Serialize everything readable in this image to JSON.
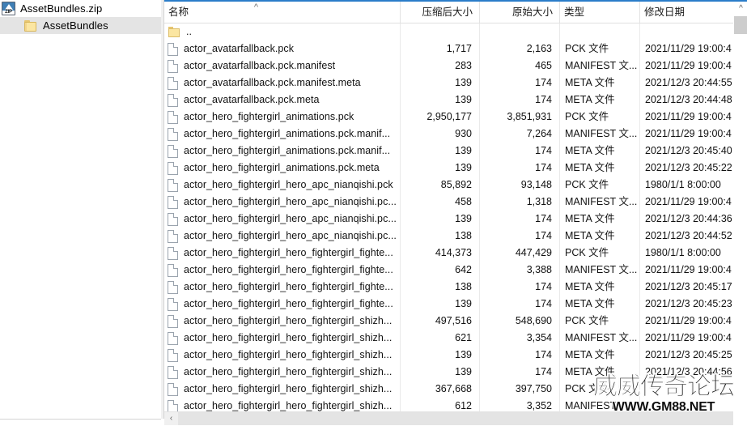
{
  "window": {
    "accent_color": "#2a7dc9"
  },
  "tree": {
    "root": {
      "label": "AssetBundles.zip",
      "icon": "zip-archive-icon"
    },
    "child": {
      "label": "AssetBundles",
      "icon": "folder-icon",
      "selected": true
    }
  },
  "list": {
    "columns": [
      {
        "key": "name",
        "label": "名称",
        "align": "left"
      },
      {
        "key": "csize",
        "label": "压缩后大小",
        "align": "right"
      },
      {
        "key": "osize",
        "label": "原始大小",
        "align": "right"
      },
      {
        "key": "type",
        "label": "类型",
        "align": "left"
      },
      {
        "key": "date",
        "label": "修改日期",
        "align": "left"
      }
    ],
    "sort": {
      "column": "名称",
      "direction": "ascending",
      "glyph": "^"
    },
    "rows": [
      {
        "icon": "folder-icon",
        "name": "..",
        "csize": "",
        "osize": "",
        "type": "",
        "date": ""
      },
      {
        "icon": "file-icon",
        "name": "actor_avatarfallback.pck",
        "csize": "1,717",
        "osize": "2,163",
        "type": "PCK 文件",
        "date": "2021/11/29 19:00:4"
      },
      {
        "icon": "file-icon",
        "name": "actor_avatarfallback.pck.manifest",
        "csize": "283",
        "osize": "465",
        "type": "MANIFEST 文...",
        "date": "2021/11/29 19:00:4"
      },
      {
        "icon": "file-icon",
        "name": "actor_avatarfallback.pck.manifest.meta",
        "csize": "139",
        "osize": "174",
        "type": "META 文件",
        "date": "2021/12/3 20:44:55"
      },
      {
        "icon": "file-icon",
        "name": "actor_avatarfallback.pck.meta",
        "csize": "139",
        "osize": "174",
        "type": "META 文件",
        "date": "2021/12/3 20:44:48"
      },
      {
        "icon": "file-icon",
        "name": "actor_hero_fightergirl_animations.pck",
        "csize": "2,950,177",
        "osize": "3,851,931",
        "type": "PCK 文件",
        "date": "2021/11/29 19:00:4"
      },
      {
        "icon": "file-icon",
        "name": "actor_hero_fightergirl_animations.pck.manif...",
        "csize": "930",
        "osize": "7,264",
        "type": "MANIFEST 文...",
        "date": "2021/11/29 19:00:4"
      },
      {
        "icon": "file-icon",
        "name": "actor_hero_fightergirl_animations.pck.manif...",
        "csize": "139",
        "osize": "174",
        "type": "META 文件",
        "date": "2021/12/3 20:45:40"
      },
      {
        "icon": "file-icon",
        "name": "actor_hero_fightergirl_animations.pck.meta",
        "csize": "139",
        "osize": "174",
        "type": "META 文件",
        "date": "2021/12/3 20:45:22"
      },
      {
        "icon": "file-icon",
        "name": "actor_hero_fightergirl_hero_apc_nianqishi.pck",
        "csize": "85,892",
        "osize": "93,148",
        "type": "PCK 文件",
        "date": "1980/1/1 8:00:00"
      },
      {
        "icon": "file-icon",
        "name": "actor_hero_fightergirl_hero_apc_nianqishi.pc...",
        "csize": "458",
        "osize": "1,318",
        "type": "MANIFEST 文...",
        "date": "2021/11/29 19:00:4"
      },
      {
        "icon": "file-icon",
        "name": "actor_hero_fightergirl_hero_apc_nianqishi.pc...",
        "csize": "139",
        "osize": "174",
        "type": "META 文件",
        "date": "2021/12/3 20:44:36"
      },
      {
        "icon": "file-icon",
        "name": "actor_hero_fightergirl_hero_apc_nianqishi.pc...",
        "csize": "138",
        "osize": "174",
        "type": "META 文件",
        "date": "2021/12/3 20:44:52"
      },
      {
        "icon": "file-icon",
        "name": "actor_hero_fightergirl_hero_fightergirl_fighte...",
        "csize": "414,373",
        "osize": "447,429",
        "type": "PCK 文件",
        "date": "1980/1/1 8:00:00"
      },
      {
        "icon": "file-icon",
        "name": "actor_hero_fightergirl_hero_fightergirl_fighte...",
        "csize": "642",
        "osize": "3,388",
        "type": "MANIFEST 文...",
        "date": "2021/11/29 19:00:4"
      },
      {
        "icon": "file-icon",
        "name": "actor_hero_fightergirl_hero_fightergirl_fighte...",
        "csize": "138",
        "osize": "174",
        "type": "META 文件",
        "date": "2021/12/3 20:45:17"
      },
      {
        "icon": "file-icon",
        "name": "actor_hero_fightergirl_hero_fightergirl_fighte...",
        "csize": "139",
        "osize": "174",
        "type": "META 文件",
        "date": "2021/12/3 20:45:23"
      },
      {
        "icon": "file-icon",
        "name": "actor_hero_fightergirl_hero_fightergirl_shizh...",
        "csize": "497,516",
        "osize": "548,690",
        "type": "PCK 文件",
        "date": "2021/11/29 19:00:4"
      },
      {
        "icon": "file-icon",
        "name": "actor_hero_fightergirl_hero_fightergirl_shizh...",
        "csize": "621",
        "osize": "3,354",
        "type": "MANIFEST 文...",
        "date": "2021/11/29 19:00:4"
      },
      {
        "icon": "file-icon",
        "name": "actor_hero_fightergirl_hero_fightergirl_shizh...",
        "csize": "139",
        "osize": "174",
        "type": "META 文件",
        "date": "2021/12/3 20:45:25"
      },
      {
        "icon": "file-icon",
        "name": "actor_hero_fightergirl_hero_fightergirl_shizh...",
        "csize": "139",
        "osize": "174",
        "type": "META 文件",
        "date": "2021/12/3 20:44:56"
      },
      {
        "icon": "file-icon",
        "name": "actor_hero_fightergirl_hero_fightergirl_shizh...",
        "csize": "367,668",
        "osize": "397,750",
        "type": "PCK 文件",
        "date": ""
      },
      {
        "icon": "file-icon",
        "name": "actor_hero_fightergirl_hero_fightergirl_shizh...",
        "csize": "612",
        "osize": "3,352",
        "type": "MANIFEST",
        "date": ""
      }
    ]
  },
  "scrollbars": {
    "vertical": {
      "up_arrow_glyph": "^"
    },
    "horizontal": {
      "left_arrow_glyph": "‹"
    }
  },
  "watermark": {
    "line1": "威威传奇论坛",
    "line2": "WWW.GM88.NET"
  }
}
